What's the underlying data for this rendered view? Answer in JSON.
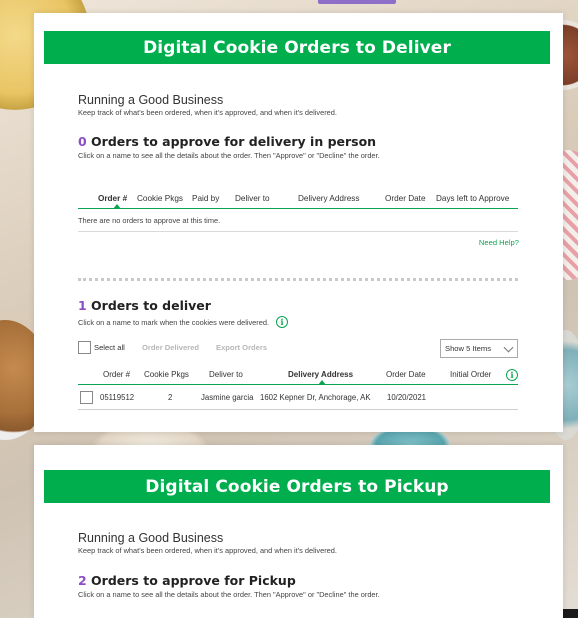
{
  "deliver_card": {
    "banner": "Digital Cookie Orders to Deliver",
    "intro": {
      "title": "Running a Good Business",
      "subtitle": "Keep track of what's been ordered, when it's approved, and when it's delivered."
    },
    "approve": {
      "count": "0",
      "heading": " Orders to approve for delivery in person",
      "instructions": "Click on a name to see all the details about the order. Then \"Approve\" or \"Decline\" the order.",
      "columns": [
        "Order #",
        "Cookie Pkgs",
        "Paid by",
        "Deliver to",
        "Delivery Address",
        "Order Date",
        "Days left to Approve"
      ],
      "empty_message": "There are no orders to approve at this time.",
      "help_link": "Need Help?"
    },
    "deliver": {
      "count": "1",
      "heading": " Orders to deliver",
      "instructions": "Click on a name to mark when the cookies were delivered.",
      "info_icon": "i",
      "select_all_label": "Select all",
      "order_delivered_label": "Order Delivered",
      "export_orders_label": "Export Orders",
      "show_items": "Show 5 Items",
      "columns": [
        "Order #",
        "Cookie Pkgs",
        "Deliver to",
        "Delivery Address",
        "Order Date",
        "Initial Order"
      ],
      "rows": [
        {
          "order_no": "05119512",
          "cookie_pkgs": "2",
          "deliver_to": "Jasmine garcia",
          "address": "1602 Kepner Dr, Anchorage, AK",
          "order_date": "10/20/2021"
        }
      ]
    }
  },
  "pickup_card": {
    "banner": "Digital Cookie Orders to Pickup",
    "intro": {
      "title": "Running a Good Business",
      "subtitle": "Keep track of what's been ordered, when it's approved, and when it's delivered."
    },
    "approve": {
      "count": "2",
      "heading": " Orders to approve for Pickup",
      "instructions": "Click on a name to see all the details about the order. Then \"Approve\" or \"Decline\" the order."
    }
  },
  "colors": {
    "brand_green": "#00ae4e",
    "count_purple": "#8c4ec6",
    "link_green": "#0aa452"
  },
  "icons": [
    "info-icon",
    "chevron-down-icon",
    "sort-caret-icon"
  ]
}
